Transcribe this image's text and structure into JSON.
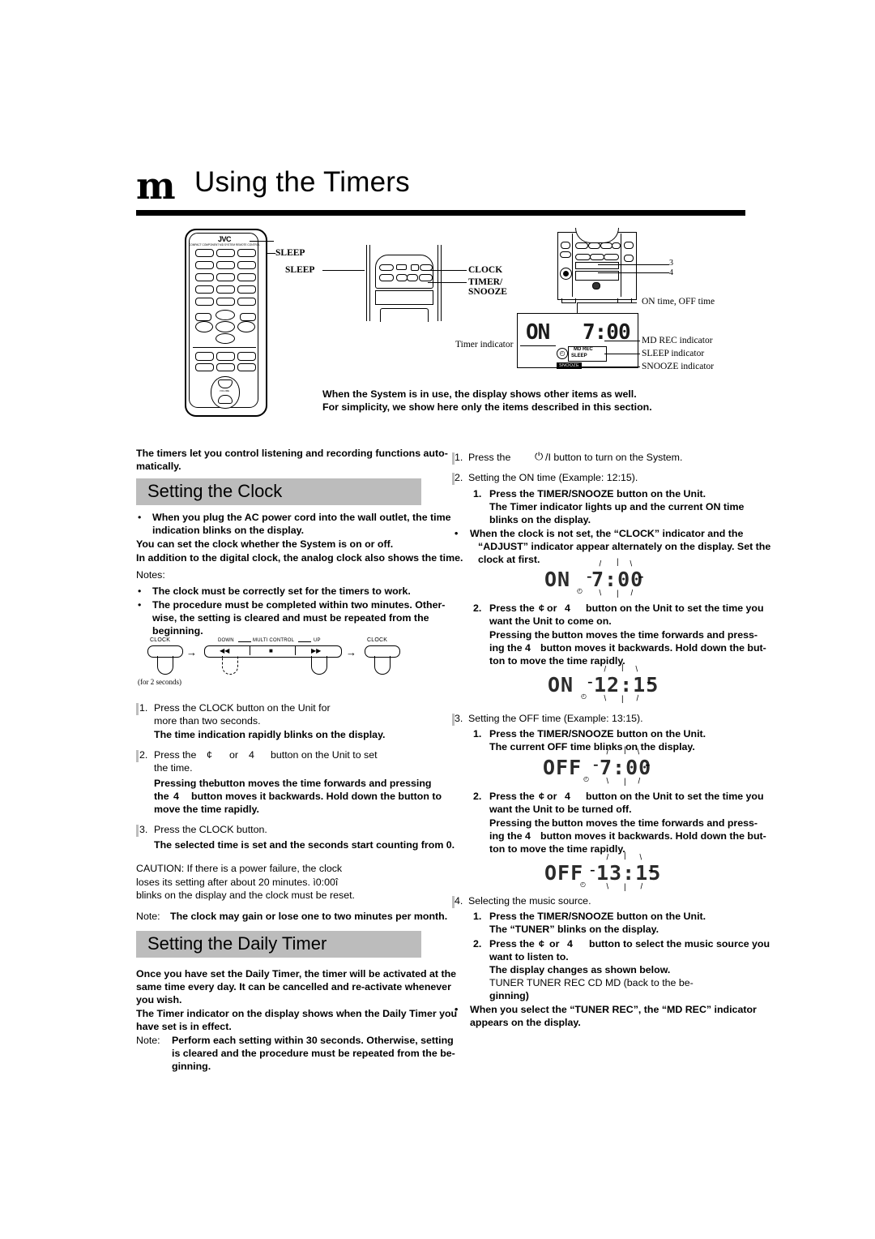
{
  "header": {
    "glyph": "m",
    "title": "Using the Timers"
  },
  "diagram": {
    "remote_brand": "JVC",
    "remote_sub": "COMPACT COMPONENT MD SYSTEM REMOTE CONTROL",
    "callouts": {
      "sleep_top": "SLEEP",
      "sleep_mid": "SLEEP",
      "clock": "CLOCK",
      "timer_snooze_l1": "TIMER/",
      "timer_snooze_l2": "SNOOZE",
      "on_off_time": "ON time, OFF time",
      "timer_indicator": "Timer indicator",
      "md_rec_indicator": "MD REC indicator",
      "sleep_indicator": "SLEEP indicator",
      "snooze_indicator": "SNOOZE indicator"
    },
    "display": {
      "mode": "ON",
      "time": "7:00",
      "md_rec": "MD REC",
      "sleep": "SLEEP",
      "snooze": "SNOOZE"
    },
    "note_line1": "When the System is in use, the display shows other items as well.",
    "note_line2": "For simplicity, we show here only the items described in this section."
  },
  "intro": {
    "line1": "The timers let you control listening and recording functions auto-",
    "line2": "matically."
  },
  "clock_section": {
    "title": "Setting the Clock",
    "bullet1_l1": "When you plug the AC power cord into the wall outlet, the time",
    "bullet1_l2": "indication blinks on the display.",
    "line_on_off": "You can set the clock whether the System is on or off.",
    "line_analog": "In addition to the digital clock, the analog clock also shows the time.",
    "notes_label": "Notes:",
    "note1": "The clock must be correctly set for the timers to work.",
    "note2_l1": "The procedure must be completed within two minutes. Other-",
    "note2_l2": "wise, the setting is cleared and must be repeated from the",
    "note2_l3": "beginning.",
    "flow": {
      "clock_left": "CLOCK",
      "down": "DOWN",
      "multi_control": "MULTI CONTROL",
      "up": "UP",
      "clock_right": "CLOCK",
      "for2sec": "(for 2 seconds)",
      "arrow": "→",
      "prev_glyph": "◀◀",
      "stop_glyph": "■",
      "next_glyph": "▶▶"
    },
    "steps": [
      {
        "num": "1.",
        "l1": "Press the CLOCK button on the Unit for",
        "l2": "more than two seconds.",
        "bold": "The time indication rapidly blinks on the display."
      },
      {
        "num": "2.",
        "l1_a": "Press the",
        "l1_b": "or",
        "l1_c": "button on the Unit to set",
        "l2": "the time.",
        "b1_a": "Pressing the",
        "b1_b": "button moves the time forwards and pressing",
        "b2_a": "the",
        "b2_b": "button moves it backwards. Hold down the button to",
        "b3": "move the time rapidly."
      },
      {
        "num": "3.",
        "l1": "Press the CLOCK button.",
        "bold": "The selected time is set and the seconds start counting from 0."
      }
    ],
    "caution_l1": "CAUTION: If there is a power failure, the clock",
    "caution_l2": "loses its setting after about 20 minutes. ì0:00î",
    "caution_l3": "blinks on the display and the clock must be reset.",
    "note_label": "Note:",
    "note_text": "The clock may gain or lose one to two minutes per month."
  },
  "daily_timer_section": {
    "title": "Setting the Daily Timer",
    "p1_l1": "Once you have set the Daily Timer, the timer will be activated at the",
    "p1_l2": "same time every day. It can be cancelled and re-activate whenever",
    "p1_l3": "you wish.",
    "p2_l1": "The Timer indicator on the display shows when the Daily Timer you",
    "p2_l2": "have set is in effect.",
    "note_label": "Note:",
    "note_l1": "Perform each setting within 30 seconds. Otherwise, setting",
    "note_l2": "is cleared and the procedure must be repeated from the be-",
    "note_l3": "ginning."
  },
  "right_column": {
    "step1": {
      "num": "1.",
      "a": "Press the",
      "power_glyph": "⏻",
      "b": "/I button to turn on the System."
    },
    "step2": {
      "num": "2.",
      "title": "Setting the ON time (Example: 12:15).",
      "sub1_num": "1.",
      "sub1_l1": "Press the TIMER/SNOOZE button on the Unit.",
      "sub1_l2": "The Timer indicator lights up and the current ON time",
      "sub1_l3": "blinks on the display.",
      "bullet_l1": "When the clock is not set, the “CLOCK” indicator and the",
      "bullet_l2": "“ADJUST” indicator appear alternately on the display. Set the",
      "bullet_l3": "clock at first.",
      "lcd1_mode": "ON",
      "lcd1_time": "7:00",
      "sub2_num": "2.",
      "sub2_l1_a": "Press the",
      "sub2_l1_b": "or",
      "sub2_l1_c": "button on the Unit to set the time you",
      "sub2_l2": "want the Unit to come on.",
      "sub2_l3_a": "Pressing the",
      "sub2_l3_b": "button moves the time forwards and press-",
      "sub2_l4_a": "ing the",
      "sub2_l4_b": "button moves it backwards. Hold down the but-",
      "sub2_l5": "ton to move the time rapidly.",
      "lcd2_mode": "ON",
      "lcd2_time": "12:15"
    },
    "step3": {
      "num": "3.",
      "title": "Setting the OFF time (Example: 13:15).",
      "sub1_num": "1.",
      "sub1_l1": "Press the TIMER/SNOOZE button on the Unit.",
      "sub1_l2": "The  current OFF time blinks on the display.",
      "lcd1_mode": "OFF",
      "lcd1_time": "7:00",
      "sub2_num": "2.",
      "sub2_l1_a": "Press the",
      "sub2_l1_b": "or",
      "sub2_l1_c": "button on the Unit to set the time you",
      "sub2_l2": "want the Unit to be turned off.",
      "sub2_l3_a": "Pressing the",
      "sub2_l3_b": "button moves the time forwards and press-",
      "sub2_l4_a": "ing the",
      "sub2_l4_b": "button moves it backwards. Hold down the but-",
      "sub2_l5": "ton to move the time rapidly.",
      "lcd2_mode": "OFF",
      "lcd2_time": "13:15"
    },
    "step4": {
      "num": "4.",
      "title": "Selecting the music source.",
      "sub1_num": "1.",
      "sub1_l1": "Press the TIMER/SNOOZE button on the Unit.",
      "sub1_l2": "The  “TUNER” blinks on the display.",
      "sub2_num": "2.",
      "sub2_l1_a": "Press the",
      "sub2_l1_b": "or",
      "sub2_l1_c": "button to select the music source you",
      "sub2_l2": "want to listen to.",
      "sub2_l3": "The display changes as shown below.",
      "sources": "TUNER    TUNER REC    CD    MD    (back to the be-",
      "sources_l2": "ginning)",
      "bullet_l1": "When you select the “TUNER REC”, the “MD REC” indicator",
      "bullet_l2": "appears on the display."
    }
  },
  "glyphs": {
    "bullet": "•",
    "prev": "¢",
    "next": "4",
    "arrow_right": "→"
  }
}
